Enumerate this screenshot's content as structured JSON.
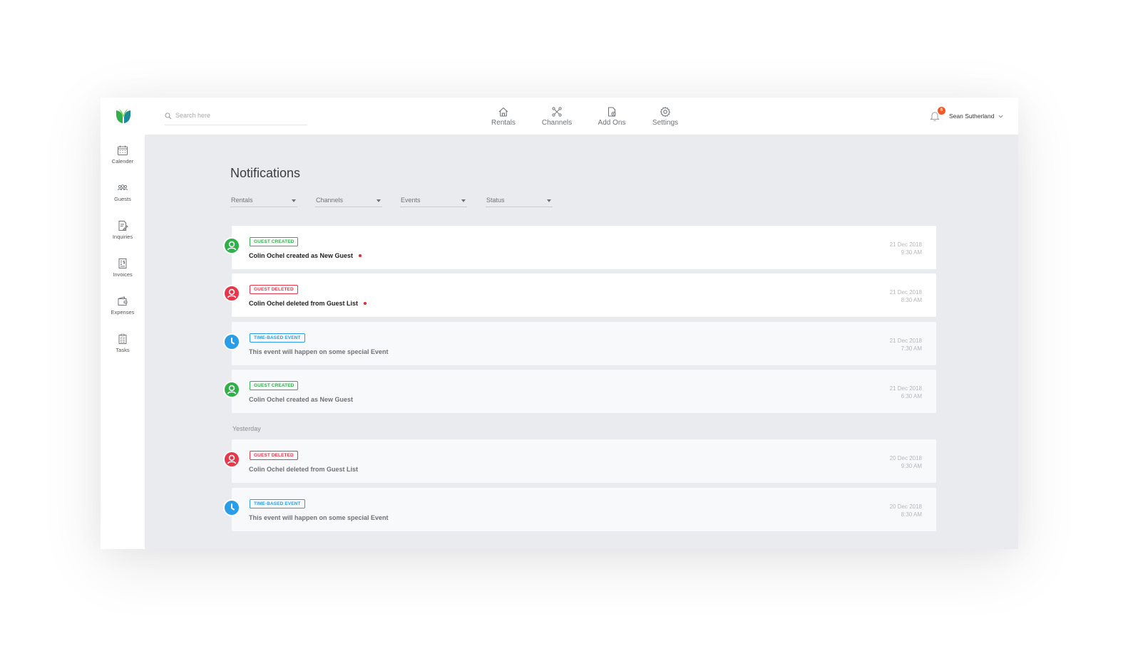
{
  "search": {
    "placeholder": "Search here"
  },
  "topnav": [
    {
      "label": "Rentals",
      "icon": "home-icon"
    },
    {
      "label": "Channels",
      "icon": "channels-icon"
    },
    {
      "label": "Add Ons",
      "icon": "add-ons-icon"
    },
    {
      "label": "Settings",
      "icon": "gear-icon"
    }
  ],
  "user": {
    "name": "Sean Sutherland",
    "notification_count": "6"
  },
  "sidebar": [
    {
      "label": "Calender",
      "icon": "calendar-icon"
    },
    {
      "label": "Guests",
      "icon": "guests-icon"
    },
    {
      "label": "Inquiries",
      "icon": "inquiries-icon"
    },
    {
      "label": "Invoices",
      "icon": "invoices-icon"
    },
    {
      "label": "Expenses",
      "icon": "wallet-icon"
    },
    {
      "label": "Tasks",
      "icon": "tasks-icon"
    }
  ],
  "page": {
    "title": "Notifications"
  },
  "filters": [
    "Rentals",
    "Channels",
    "Events",
    "Status"
  ],
  "colors": {
    "green": "#2fb04a",
    "red": "#e8364a",
    "blue": "#2a9de8",
    "unread_dot": "#e8262d"
  },
  "notifications": [
    {
      "tag": "GUEST CREATED",
      "type": "green",
      "message": "Colin Ochel created as New Guest",
      "date": "21 Dec 2018",
      "time": "9:30 AM",
      "unread": true
    },
    {
      "tag": "GUEST DELETED",
      "type": "red",
      "message": "Colin Ochel deleted from Guest List",
      "date": "21 Dec 2018",
      "time": "8:30 AM",
      "unread": true
    },
    {
      "tag": "TIME-BASED EVENT",
      "type": "blue",
      "message": "This event will happen on some special Event",
      "date": "21 Dec 2018",
      "time": "7:30 AM",
      "unread": false
    },
    {
      "tag": "GUEST CREATED",
      "type": "green",
      "message": "Colin Ochel created as New Guest",
      "date": "21 Dec 2018",
      "time": "6:30 AM",
      "unread": false
    }
  ],
  "section_label": "Yesterday",
  "notifications_yesterday": [
    {
      "tag": "GUEST DELETED",
      "type": "red",
      "message": "Colin Ochel deleted from Guest List",
      "date": "20 Dec 2018",
      "time": "9:30 AM",
      "unread": false
    },
    {
      "tag": "TIME-BASED EVENT",
      "type": "blue",
      "message": "This event will happen on some special Event",
      "date": "20 Dec 2018",
      "time": "8:30 AM",
      "unread": false
    }
  ]
}
